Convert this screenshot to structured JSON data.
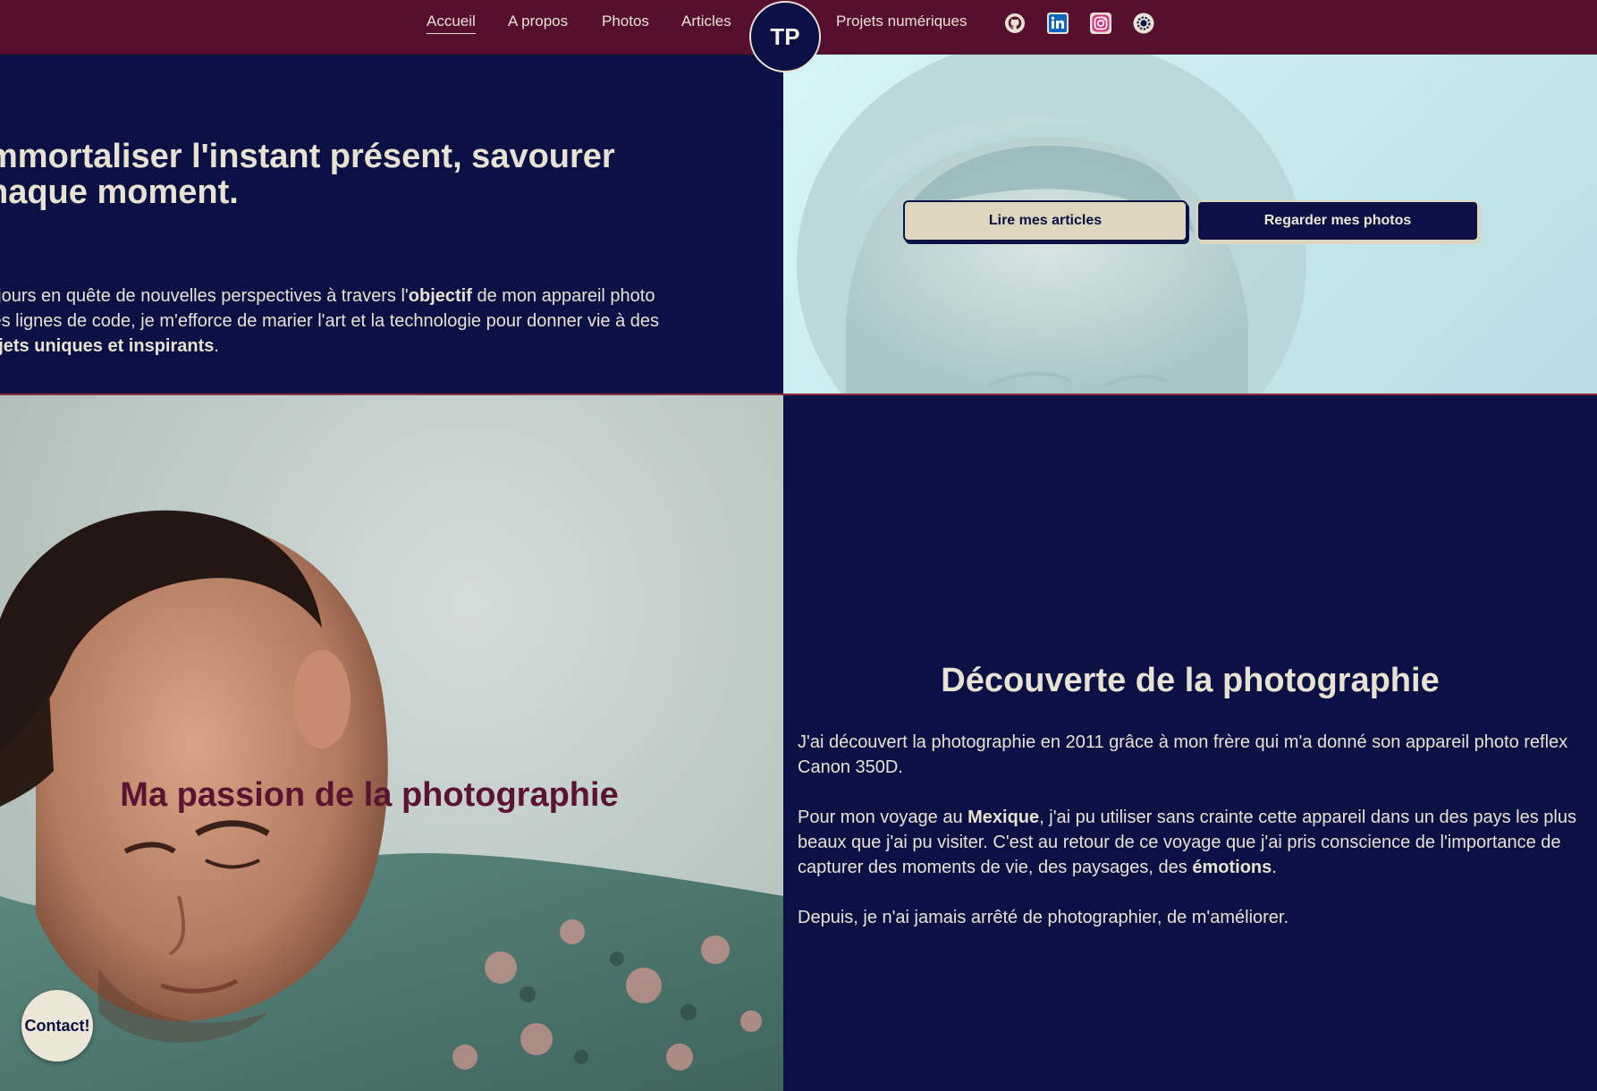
{
  "nav": {
    "links": [
      {
        "label": "Accueil",
        "active": true
      },
      {
        "label": "A propos"
      },
      {
        "label": "Photos"
      },
      {
        "label": "Articles"
      },
      {
        "label": "Projets numériques"
      }
    ],
    "logo": "TP",
    "social_icons": [
      "github-icon",
      "linkedin-icon",
      "instagram-icon",
      "settings-icon"
    ]
  },
  "hero": {
    "title_line1": "mmortaliser l'instant présent, savourer",
    "title_line2": "haque moment.",
    "text": {
      "line1_before": "ujours en quête de nouvelles perspectives à travers l'",
      "line1_bold": "objectif",
      "line1_after": " de mon appareil photo",
      "line2": " les lignes de code, je m'efforce de marier l'art et la technologie pour donner vie à des",
      "line3_bold": "ojets uniques et inspirants",
      "line3_after": "."
    },
    "buttons": {
      "articles": "Lire mes articles",
      "photos": "Regarder mes photos"
    }
  },
  "passion": {
    "title": "Ma passion de la photographie"
  },
  "discovery": {
    "title": "Découverte de la photographie",
    "p1": "J'ai découvert la photographie en 2011 grâce à mon frère qui m'a donné son appareil photo reflex Canon 350D.",
    "p2_before": "Pour mon voyage au ",
    "p2_bold1": "Mexique",
    "p2_middle": ", j'ai pu utiliser sans crainte cette appareil dans un des pays les plus beaux que j'ai pu visiter. C'est au retour de ce voyage que j'ai pris conscience de l'importance de capturer des moments de vie, des paysages, des ",
    "p2_bold2": "émotions",
    "p2_after": ".",
    "p3": "Depuis, je n'ai jamais arrêté de photographier, de m'améliorer."
  },
  "contact": {
    "label": "Contact!"
  },
  "colors": {
    "nav_bg": "#560f2f",
    "navy": "#0b1145",
    "cream": "#e8e2d2",
    "burgundy_title": "#5a1330"
  }
}
